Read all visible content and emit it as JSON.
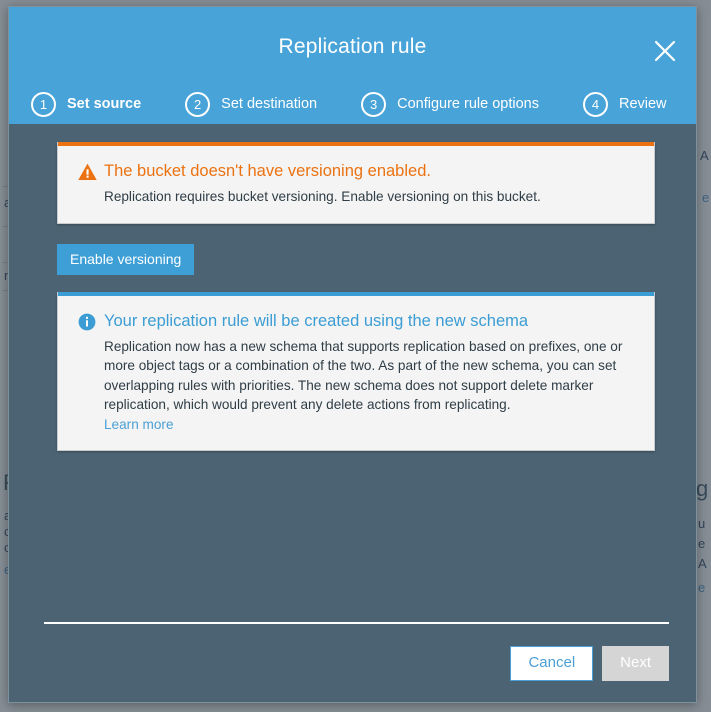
{
  "modal": {
    "title": "Replication rule",
    "close_icon": "close-icon",
    "steps": [
      {
        "number": "1",
        "label": "Set source",
        "active": true
      },
      {
        "number": "2",
        "label": "Set destination",
        "active": false
      },
      {
        "number": "3",
        "label": "Configure rule options",
        "active": false
      },
      {
        "number": "4",
        "label": "Review",
        "active": false
      }
    ],
    "warning": {
      "icon": "warning-triangle-icon",
      "heading": "The bucket doesn't have versioning enabled.",
      "body": "Replication requires bucket versioning. Enable versioning on this bucket.",
      "accent_color": "#ec7211"
    },
    "enable_versioning_label": "Enable versioning",
    "info": {
      "icon": "info-circle-icon",
      "heading": "Your replication rule will be created using the new schema",
      "body": "Replication now has a new schema that supports replication based on prefixes, one or more object tags or a combination of the two. As part of the new schema, you can set overlapping rules with priorities. The new schema does not support delete marker replication, which would prevent any delete actions from replicating.",
      "link": "Learn more",
      "accent_color": "#3b9dd4"
    },
    "footer": {
      "cancel_label": "Cancel",
      "next_label": "Next"
    },
    "colors": {
      "header": "#48a3d8",
      "body": "#4b6373",
      "primary": "#3d9fd6",
      "warning": "#ec7211",
      "info": "#3b9dd4",
      "disabled": "#d5d5d5"
    }
  },
  "background": {
    "left_fragments": [
      "a",
      "n",
      "R",
      "a",
      "c",
      "o",
      "e"
    ],
    "right_fragments": [
      "A",
      "e",
      "g",
      "u",
      "e",
      "A",
      "e"
    ]
  }
}
